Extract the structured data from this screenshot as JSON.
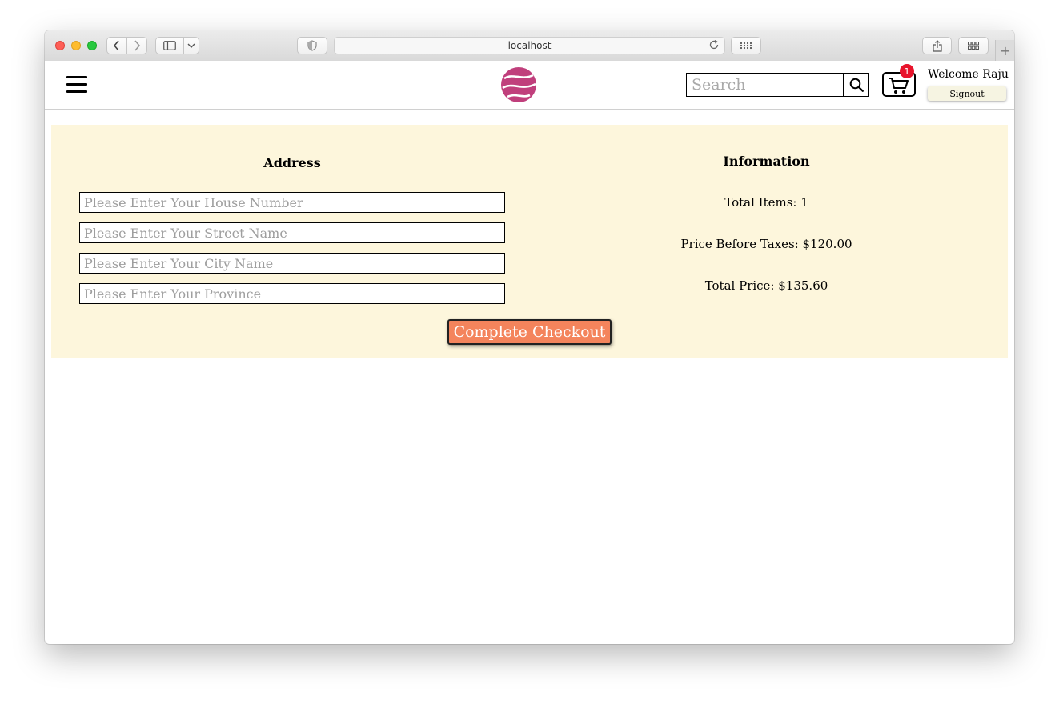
{
  "browser": {
    "url": "localhost",
    "new_tab_label": "+"
  },
  "navbar": {
    "search_placeholder": "Search",
    "cart_count": "1",
    "welcome_text": "Welcome Raju",
    "signout_label": "Signout"
  },
  "address": {
    "heading": "Address",
    "house_placeholder": "Please Enter Your House Number",
    "street_placeholder": "Please Enter Your Street Name",
    "city_placeholder": "Please Enter Your City Name",
    "province_placeholder": "Please Enter Your Province"
  },
  "information": {
    "heading": "Information",
    "total_items": "Total Items: 1",
    "price_before_taxes": "Price Before Taxes: $120.00",
    "total_price": "Total Price: $135.60"
  },
  "checkout": {
    "button_label": "Complete Checkout",
    "button_color": "#f4845c",
    "panel_color": "#fdf6dc"
  },
  "colors": {
    "logo": "#c03f7c",
    "badge": "#e8132b"
  }
}
